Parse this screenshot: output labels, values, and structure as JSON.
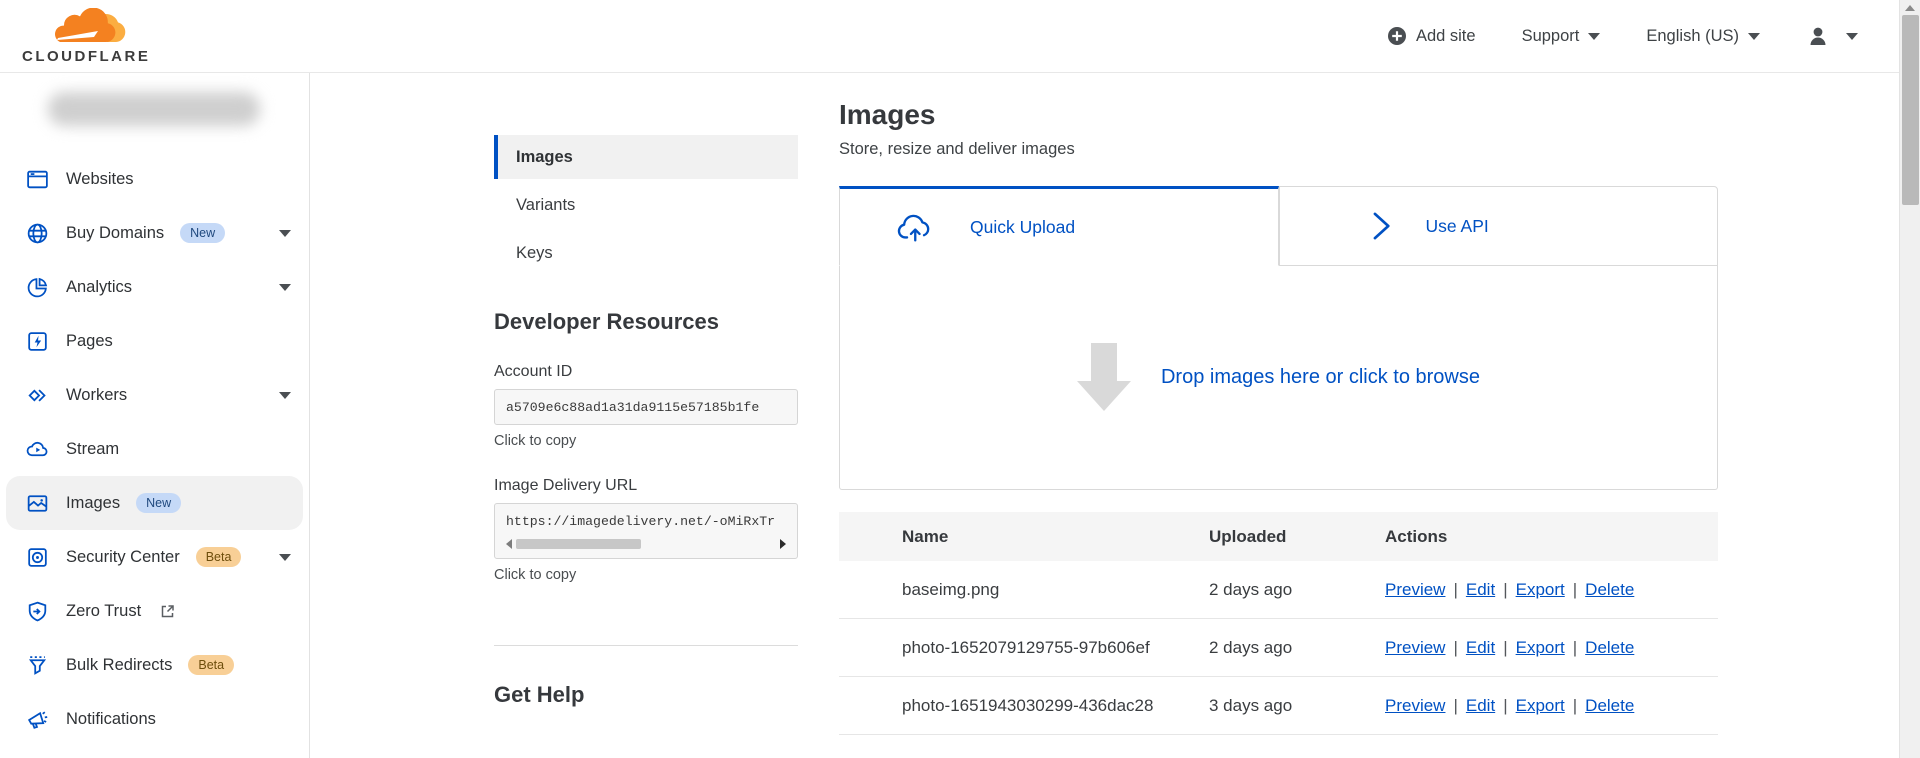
{
  "header": {
    "logo_word": "CLOUDFLARE",
    "add_site": "Add site",
    "support": "Support",
    "language": "English (US)"
  },
  "sidebar": {
    "items": [
      {
        "label": "Websites"
      },
      {
        "label": "Buy Domains",
        "badge": "New"
      },
      {
        "label": "Analytics"
      },
      {
        "label": "Pages"
      },
      {
        "label": "Workers"
      },
      {
        "label": "Stream"
      },
      {
        "label": "Images",
        "badge": "New"
      },
      {
        "label": "Security Center",
        "badge": "Beta"
      },
      {
        "label": "Zero Trust"
      },
      {
        "label": "Bulk Redirects",
        "badge": "Beta"
      },
      {
        "label": "Notifications"
      }
    ]
  },
  "subnav": {
    "items": [
      {
        "label": "Images"
      },
      {
        "label": "Variants"
      },
      {
        "label": "Keys"
      }
    ],
    "developer_resources_title": "Developer Resources",
    "account_id_label": "Account ID",
    "account_id_value": "a5709e6c88ad1a31da9115e57185b1fe",
    "account_click_to_copy": "Click to copy",
    "delivery_url_label": "Image Delivery URL",
    "delivery_url_value": "https://imagedelivery.net/-oMiRxTr",
    "delivery_click_to_copy": "Click to copy",
    "get_help_title": "Get Help"
  },
  "main": {
    "title": "Images",
    "subtitle": "Store, resize and deliver images",
    "tabs": [
      {
        "label": "Quick Upload"
      },
      {
        "label": "Use API"
      }
    ],
    "dropzone_text": "Drop images here or click to browse",
    "table": {
      "columns": {
        "name": "Name",
        "uploaded": "Uploaded",
        "actions": "Actions"
      },
      "action_labels": {
        "preview": "Preview",
        "edit": "Edit",
        "export": "Export",
        "delete": "Delete"
      },
      "action_separator": "|",
      "rows": [
        {
          "name": "baseimg.png",
          "uploaded": "2 days ago"
        },
        {
          "name": "photo-1652079129755-97b606ef",
          "uploaded": "2 days ago"
        },
        {
          "name": "photo-1651943030299-436dac28",
          "uploaded": "3 days ago"
        }
      ]
    }
  },
  "colors": {
    "accent_blue": "#0051c3",
    "logo_orange": "#f48120",
    "logo_orange_light": "#fbad41",
    "badge_new_bg": "#c5d9f7",
    "badge_new_text": "#20497e",
    "badge_beta_bg": "#f8cf96",
    "badge_beta_text": "#6e4e0c"
  }
}
